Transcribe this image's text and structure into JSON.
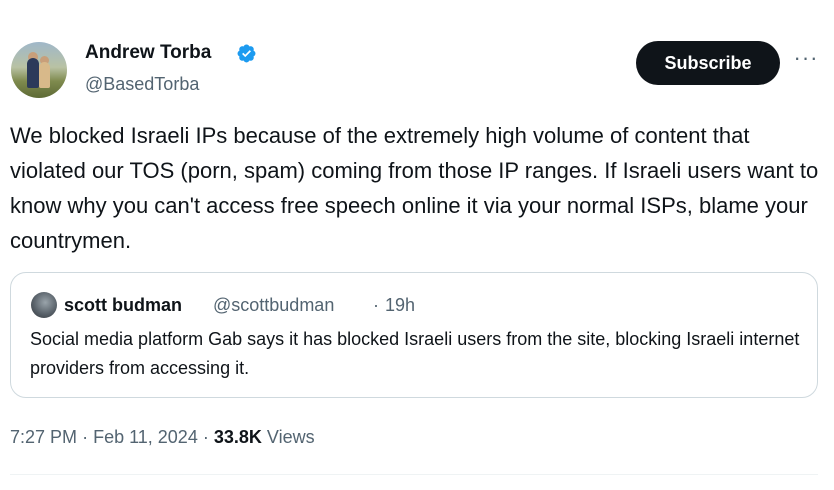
{
  "author": {
    "name": "Andrew Torba",
    "handle": "@BasedTorba",
    "verified_color": "#1d9bf0"
  },
  "actions": {
    "subscribe_label": "Subscribe",
    "more_label": "···"
  },
  "tweet": {
    "text": "We blocked Israeli IPs because of the extremely high volume of content that violated our TOS (porn, spam) coming from those IP ranges. If Israeli users want to know why you can't access free speech online it via your normal ISPs, blame your countrymen."
  },
  "quote": {
    "name": "scott budman",
    "handle": "@scottbudman",
    "separator": "·",
    "time": "19h",
    "text": "Social  media platform Gab says it has blocked Israeli users from the site, blocking Israeli internet providers from accessing it."
  },
  "meta": {
    "time": "7:27 PM",
    "date": "Feb 11, 2024",
    "separator": "·",
    "views_count": "33.8K",
    "views_label": "Views"
  },
  "colors": {
    "text_primary": "#0f1419",
    "text_secondary": "#536471",
    "border": "#cfd9de",
    "button_bg": "#0f1419",
    "button_text": "#ffffff"
  },
  "icons": [
    "verified-badge-icon",
    "more-options-icon"
  ]
}
